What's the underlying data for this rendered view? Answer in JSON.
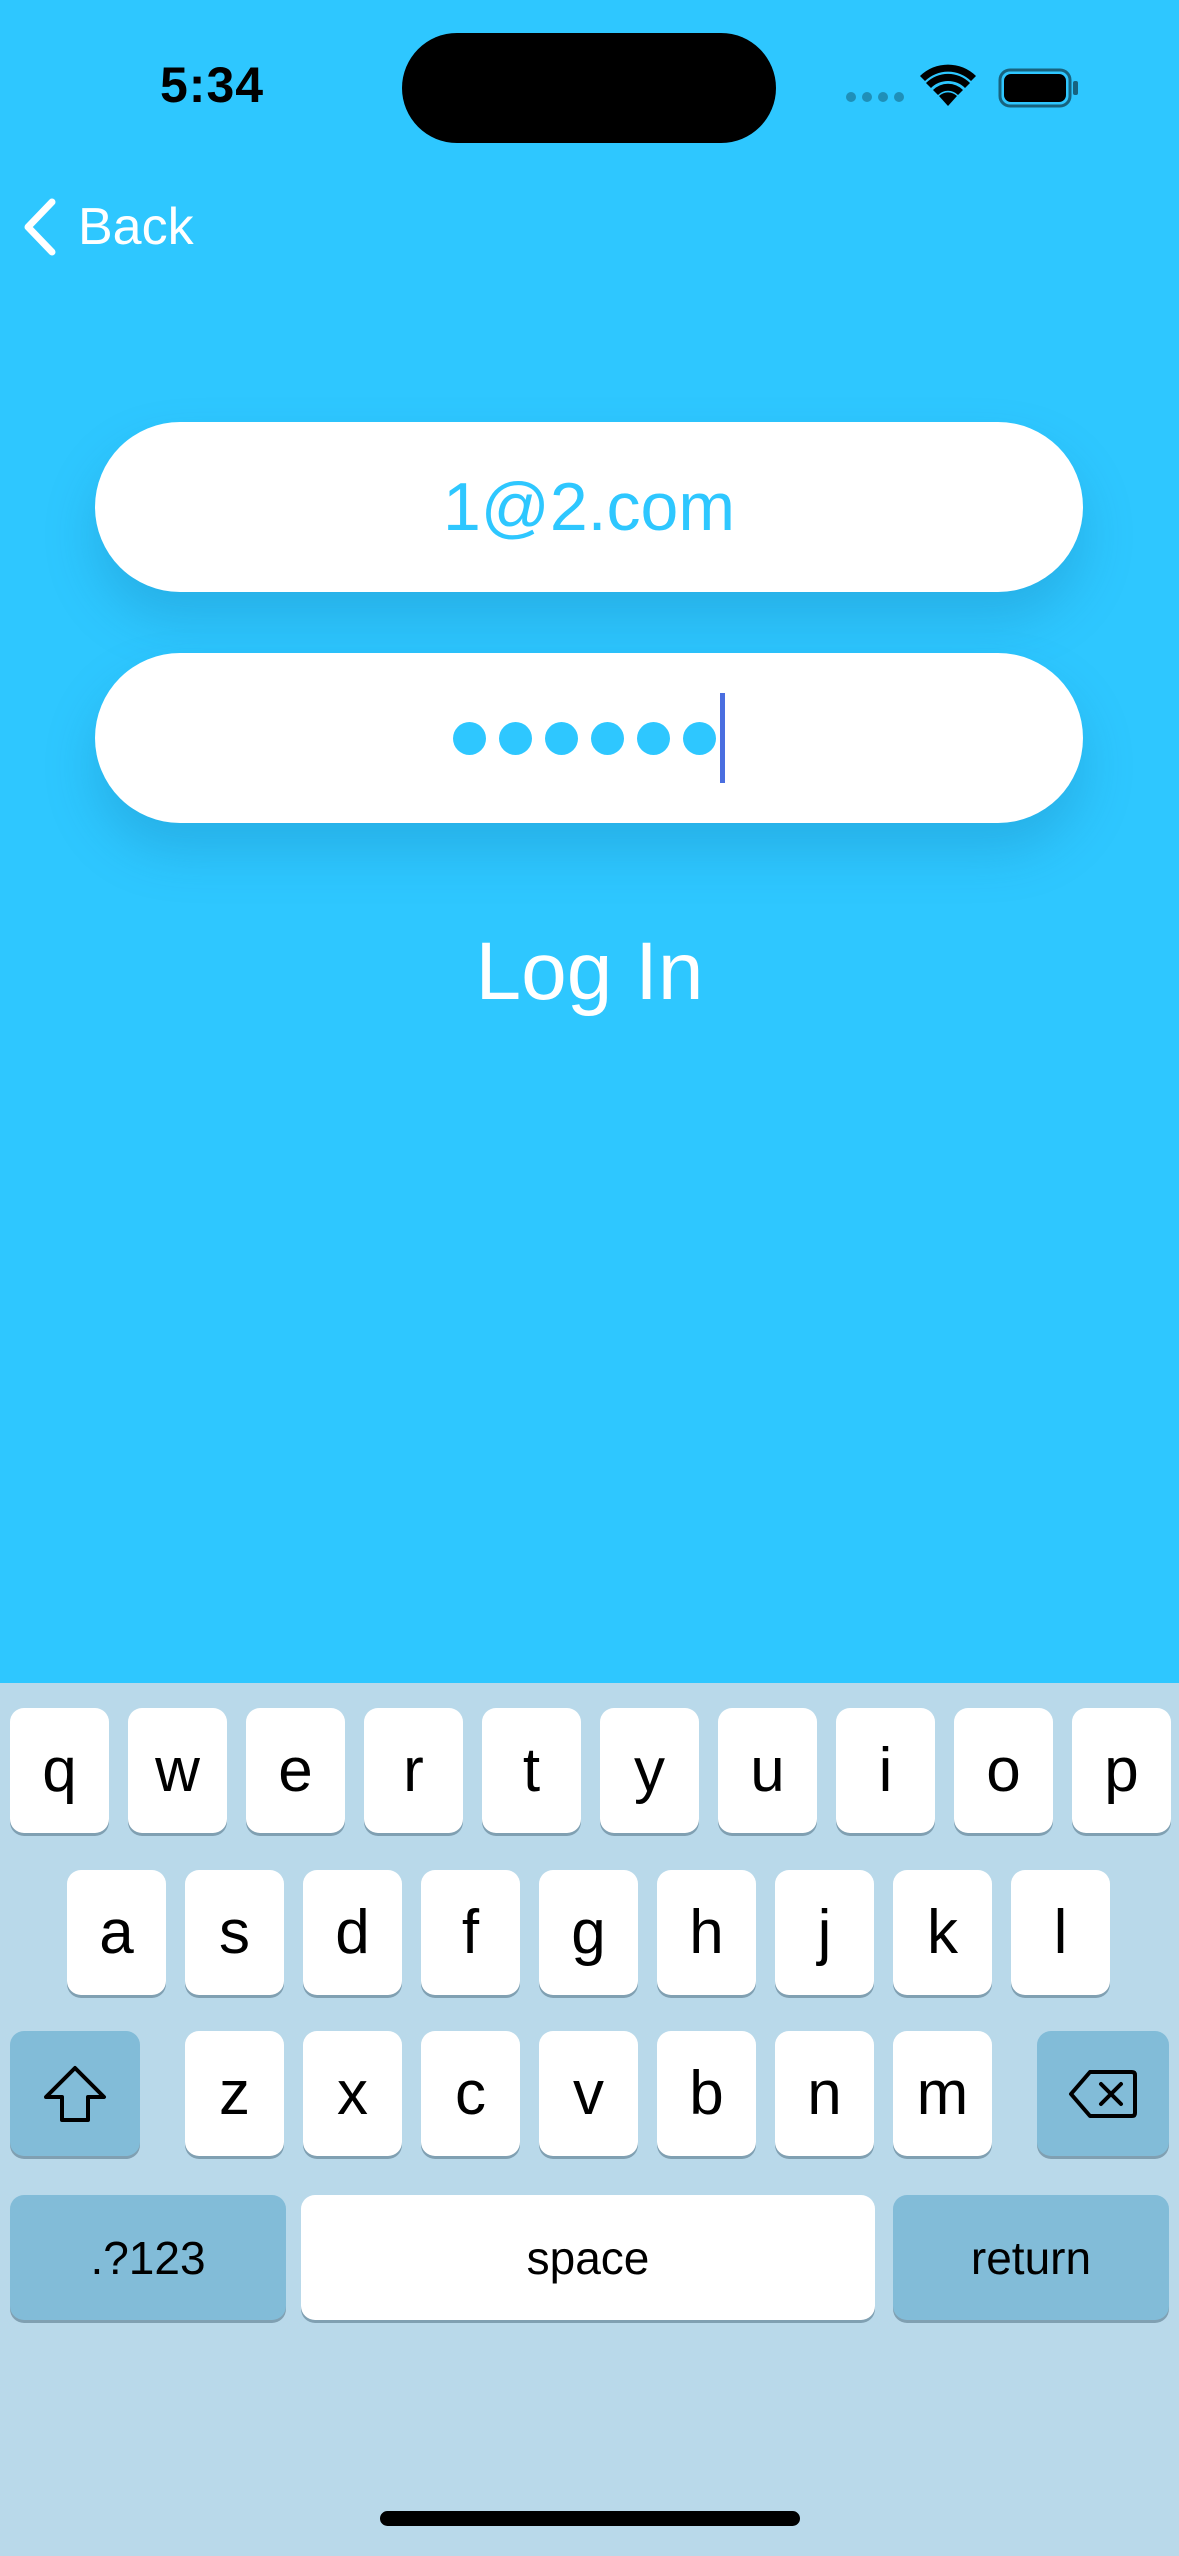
{
  "colors": {
    "background": "#2ec7ff",
    "keyboard": "#b9d9ea",
    "special_key": "#82bcd8",
    "caret": "#4a6ee0"
  },
  "status_bar": {
    "time": "5:34"
  },
  "nav": {
    "back_label": "Back"
  },
  "form": {
    "email_value": "1@2.com",
    "password_masked_count": 6,
    "login_label": "Log In"
  },
  "keyboard": {
    "row1": [
      "q",
      "w",
      "e",
      "r",
      "t",
      "y",
      "u",
      "i",
      "o",
      "p"
    ],
    "row2": [
      "a",
      "s",
      "d",
      "f",
      "g",
      "h",
      "j",
      "k",
      "l"
    ],
    "row3": [
      "z",
      "x",
      "c",
      "v",
      "b",
      "n",
      "m"
    ],
    "numbers_label": ".?123",
    "space_label": "space",
    "return_label": "return"
  }
}
